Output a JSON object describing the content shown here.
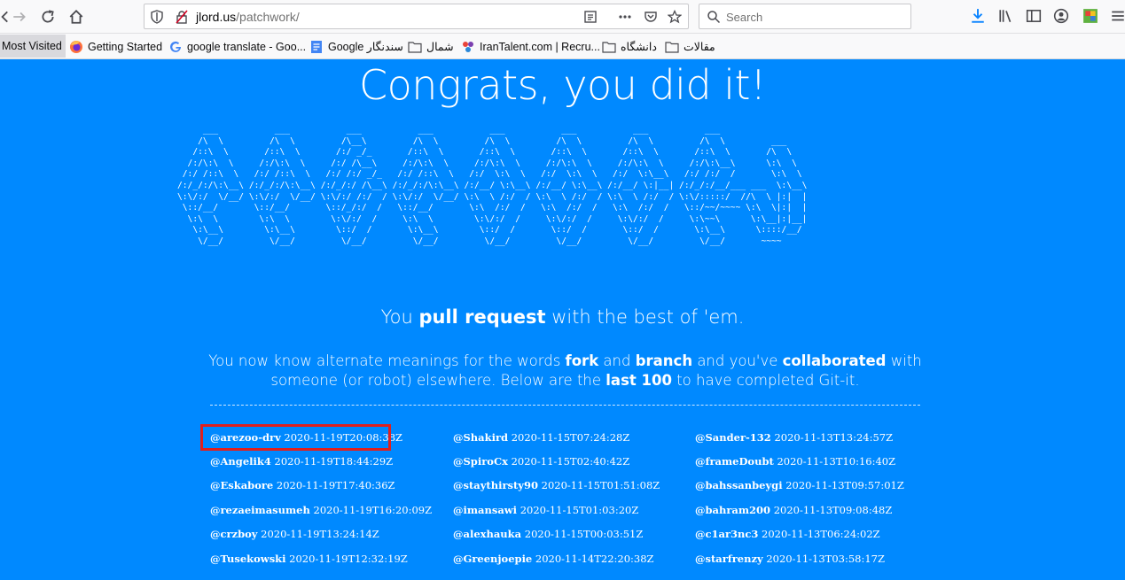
{
  "browser": {
    "url_host": "jlord.us",
    "url_path": "/patchwork/",
    "search_placeholder": "Search",
    "bookmarks": [
      {
        "label": "Most Visited",
        "icon": "star-icon"
      },
      {
        "label": "Getting Started",
        "icon": "firefox-icon"
      },
      {
        "label": "google translate - Goo...",
        "icon": "google-icon"
      },
      {
        "label": "Google سندنگار",
        "icon": "docs-icon"
      },
      {
        "label": "شمال",
        "icon": "folder-icon"
      },
      {
        "label": "IranTalent.com | Recru...",
        "icon": "irantalent-icon"
      },
      {
        "label": "دانشگاه",
        "icon": "folder-icon"
      },
      {
        "label": "مقالات",
        "icon": "folder-icon"
      }
    ]
  },
  "page": {
    "title": "Congrats, you did it!",
    "ascii_art": "     ___           ___           ___           ___           ___           ___           ___           ___              \n    /\\  \\         /\\  \\         /\\__\\         /\\  \\         /\\  \\         /\\  \\         /\\  \\         /\\  \\         ___ \n   /::\\  \\       /::\\  \\       /:/ _/_       /::\\  \\       /::\\  \\       /::\\  \\       /::\\  \\       /::\\  \\       /\\  \\ \n  /:/\\:\\  \\     /:/\\:\\  \\     /:/ /\\__\\     /:/\\:\\  \\     /:/\\:\\  \\     /:/\\:\\  \\     /:/\\:\\  \\     /:/\\:\\__\\      \\:\\  \\ \n /:/ /::\\  \\   /:/ /::\\  \\   /:/ /:/ _/_   /:/ /::\\  \\   /:/  \\:\\  \\   /:/  \\:\\  \\   /:/  \\:\\__\\   /:/ /:/  /       \\:\\  \\ \n/:/_/:/\\:\\__\\ /:/_/:/\\:\\__\\ /:/_/:/ /\\__\\ /:/_/:/\\:\\__\\ /:/__/ \\:\\__\\ /:/__/ \\:\\__\\ /:/__/ \\:|__| /:/_/:/__/___ ___  \\:\\__\\\n\\:\\/:/  \\/__/ \\:\\/:/  \\/__/ \\:\\/:/ /:/  / \\:\\/:/  \\/__/ \\:\\  \\ /:/  / \\:\\  \\ /:/  / \\:\\  \\ /:/  / \\:\\/:::::/  //\\  \\ |:|  |\n \\::/__/       \\::/__/       \\::/_/:/  /   \\::/__/       \\:\\  /:/  /   \\:\\  /:/  /   \\:\\  /:/  /   \\::/~~/~~~~ \\:\\  \\|:|  |\n  \\:\\  \\        \\:\\  \\        \\:\\/:/  /     \\:\\  \\        \\:\\/:/  /     \\:\\/:/  /     \\:\\/:/  /     \\:\\~~\\      \\:\\__|:|__|\n   \\:\\__\\        \\:\\__\\        \\::/  /       \\:\\__\\        \\::/  /       \\::/  /       \\::/  /       \\:\\__\\      \\::::/__/ \n    \\/__/         \\/__/         \\/__/         \\/__/         \\/__/         \\/__/         \\/__/         \\/__/       ~~~~     ",
    "subtitle_pre": "You ",
    "subtitle_bold": "pull request",
    "subtitle_post": " with the best of 'em.",
    "body_1": "You now know alternate meanings for the words ",
    "body_fork": "fork",
    "body_2": " and ",
    "body_branch": "branch",
    "body_3": " and you've ",
    "body_collab": "collaborated",
    "body_4": " with someone (or robot) elsewhere. Below are the ",
    "body_last100": "last 100",
    "body_5": " to have completed Git-it."
  },
  "completions": {
    "col1": [
      {
        "user": "@arezoo-drv",
        "time": "2020-11-19T20:08:38Z"
      },
      {
        "user": "@Angelik4",
        "time": "2020-11-19T18:44:29Z"
      },
      {
        "user": "@Eskabore",
        "time": "2020-11-19T17:40:36Z"
      },
      {
        "user": "@rezaeimasumeh",
        "time": "2020-11-19T16:20:09Z"
      },
      {
        "user": "@crzboy",
        "time": "2020-11-19T13:24:14Z"
      },
      {
        "user": "@Tusekowski",
        "time": "2020-11-19T12:32:19Z"
      }
    ],
    "col2": [
      {
        "user": "@Shakird",
        "time": "2020-11-15T07:24:28Z"
      },
      {
        "user": "@SpiroCx",
        "time": "2020-11-15T02:40:42Z"
      },
      {
        "user": "@staythirsty90",
        "time": "2020-11-15T01:51:08Z"
      },
      {
        "user": "@imansawi",
        "time": "2020-11-15T01:03:20Z"
      },
      {
        "user": "@alexhauka",
        "time": "2020-11-15T00:03:51Z"
      },
      {
        "user": "@Greenjoepie",
        "time": "2020-11-14T22:20:38Z"
      }
    ],
    "col3": [
      {
        "user": "@Sander-132",
        "time": "2020-11-13T13:24:57Z"
      },
      {
        "user": "@frameDoubt",
        "time": "2020-11-13T10:16:40Z"
      },
      {
        "user": "@bahssanbeygi",
        "time": "2020-11-13T09:57:01Z"
      },
      {
        "user": "@bahram200",
        "time": "2020-11-13T09:08:48Z"
      },
      {
        "user": "@c1ar3nc3",
        "time": "2020-11-13T06:24:02Z"
      },
      {
        "user": "@starfrenzy",
        "time": "2020-11-13T03:58:17Z"
      }
    ]
  },
  "colors": {
    "page_bg": "#0089ff",
    "highlight": "#e0201e"
  }
}
